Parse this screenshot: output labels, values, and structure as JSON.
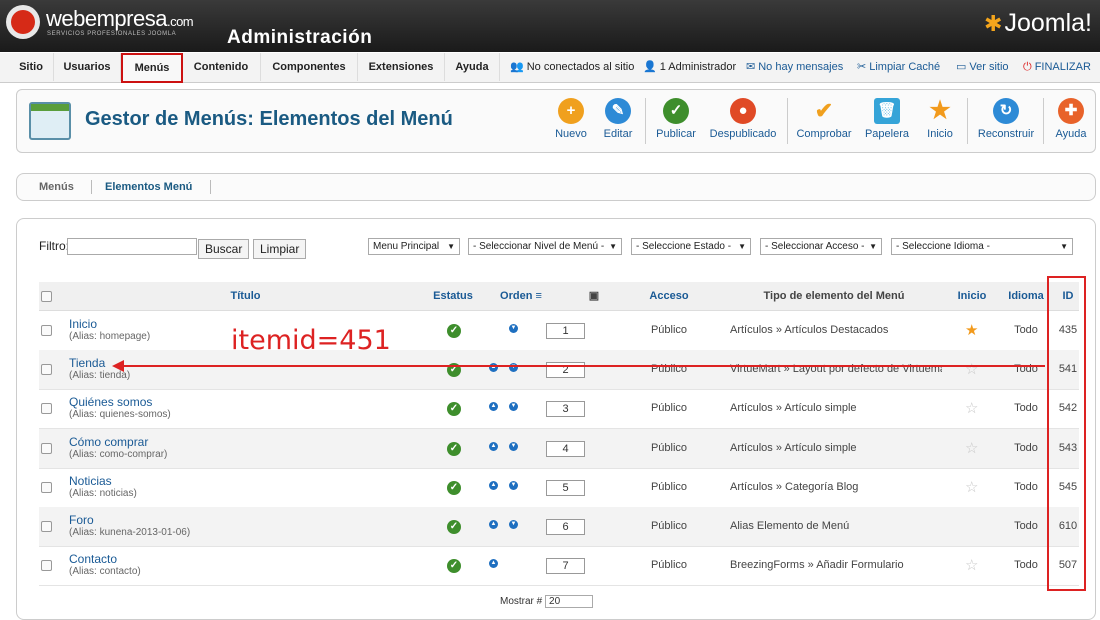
{
  "header": {
    "logo_name": "webempresa",
    "logo_suffix": ".com",
    "logo_sub": "SERVICIOS PROFESIONALES JOOMLA",
    "admin_title": "Administración",
    "joomla_label": "Joomla!"
  },
  "menubar": {
    "items": [
      "Sitio",
      "Usuarios",
      "Menús",
      "Contenido",
      "Componentes",
      "Extensiones",
      "Ayuda"
    ],
    "status": {
      "not_connected": "No conectados al sitio",
      "admins": "1 Administrador",
      "messages": "No hay mensajes",
      "clear_cache": "Limpiar Caché",
      "view_site": "Ver sitio",
      "logout": "FINALIZAR"
    }
  },
  "toolbar": {
    "title": "Gestor de Menús: Elementos del Menú",
    "buttons": {
      "new": "Nuevo",
      "edit": "Editar",
      "publish": "Publicar",
      "unpublish": "Despublicado",
      "check": "Comprobar",
      "trash": "Papelera",
      "home": "Inicio",
      "rebuild": "Reconstruir",
      "help": "Ayuda"
    }
  },
  "submenu": {
    "menus": "Menús",
    "items": "Elementos Menú"
  },
  "filters": {
    "label": "Filtro:",
    "search_button": "Buscar",
    "clear_button": "Limpiar",
    "menu_select": "Menu Principal",
    "level_select": "- Seleccionar Nivel de Menú -",
    "state_select": "- Seleccione Estado -",
    "access_select": "- Seleccionar Acceso -",
    "language_select": "- Seleccione Idioma -"
  },
  "table": {
    "headers": {
      "title": "Título",
      "status": "Estatus",
      "order": "Orden",
      "access": "Acceso",
      "type": "Tipo de elemento del Menú",
      "home": "Inicio",
      "language": "Idioma",
      "id": "ID"
    },
    "alias_label": "Alias:",
    "rows": [
      {
        "title": "Inicio",
        "alias": "homepage",
        "order": "1",
        "access": "Público",
        "type": "Artículos » Artículos Destacados",
        "home": true,
        "language": "Todo",
        "id": "435"
      },
      {
        "title": "Tienda",
        "alias": "tienda",
        "order": "2",
        "access": "Público",
        "type": "VirtueMart » Layout por defecto de Virtuemart",
        "home": false,
        "language": "Todo",
        "id": "541"
      },
      {
        "title": "Quiénes somos",
        "alias": "quienes-somos",
        "order": "3",
        "access": "Público",
        "type": "Artículos » Artículo simple",
        "home": false,
        "language": "Todo",
        "id": "542"
      },
      {
        "title": "Cómo comprar",
        "alias": "como-comprar",
        "order": "4",
        "access": "Público",
        "type": "Artículos » Artículo simple",
        "home": false,
        "language": "Todo",
        "id": "543"
      },
      {
        "title": "Noticias",
        "alias": "noticias",
        "order": "5",
        "access": "Público",
        "type": "Artículos » Categoría Blog",
        "home": false,
        "language": "Todo",
        "id": "545"
      },
      {
        "title": "Foro",
        "alias": "kunena-2013-01-06",
        "order": "6",
        "access": "Público",
        "type": "Alias Elemento de Menú",
        "home": null,
        "language": "Todo",
        "id": "610"
      },
      {
        "title": "Contacto",
        "alias": "contacto",
        "order": "7",
        "access": "Público",
        "type": "BreezingForms » Añadir Formulario",
        "home": false,
        "language": "Todo",
        "id": "507"
      }
    ]
  },
  "annotation": {
    "text": "itemid=451",
    "color": "#dd2222"
  },
  "footer": {
    "show_label": "Mostrar #",
    "show_value": "20"
  }
}
